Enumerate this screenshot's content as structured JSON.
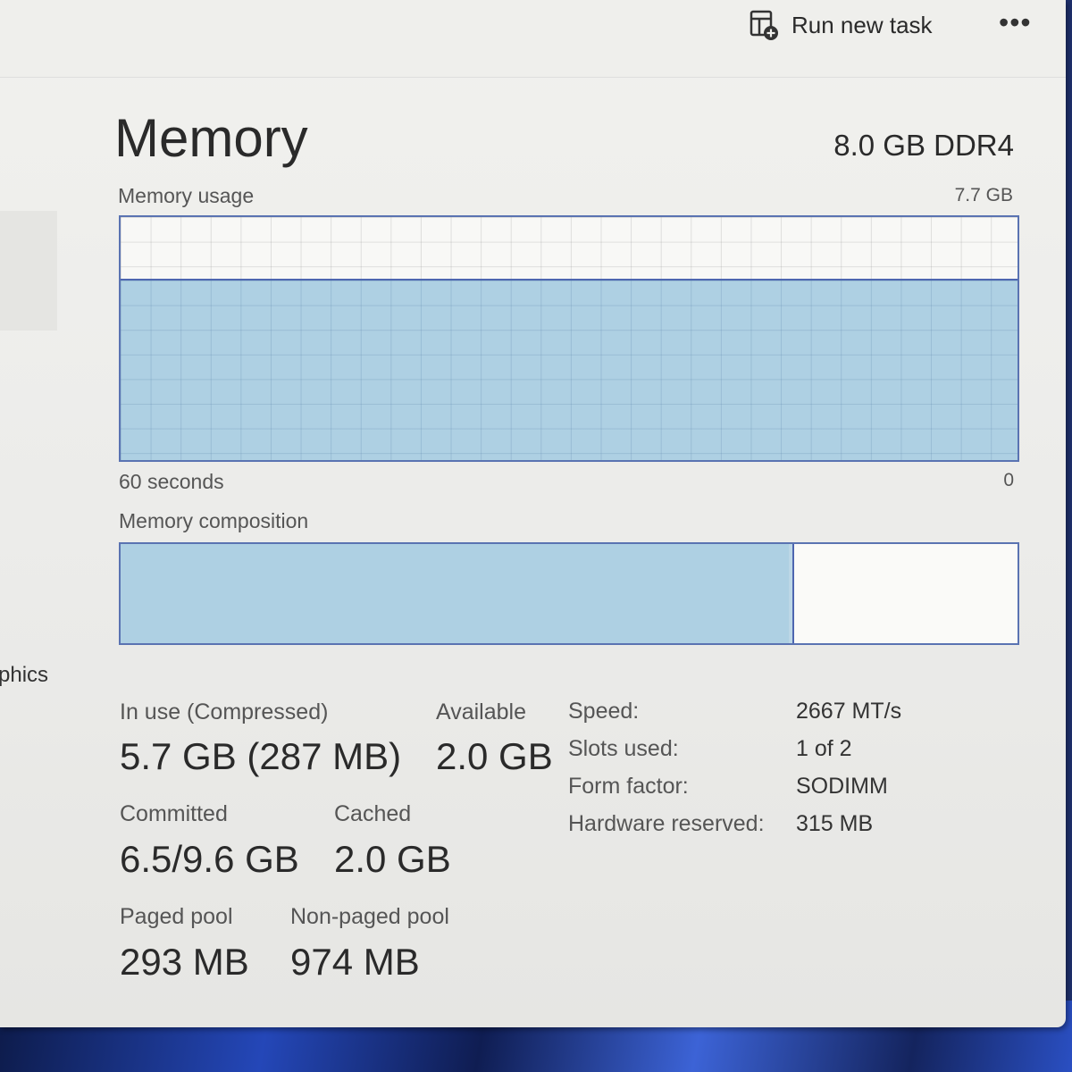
{
  "toolbar": {
    "run_new_task_label": "Run new task",
    "run_new_task_icon": "run-task-icon",
    "more_label": "•••"
  },
  "sidebar": {
    "partial_item_label": "phics"
  },
  "header": {
    "title": "Memory",
    "spec": "8.0 GB DDR4"
  },
  "usage": {
    "label": "Memory usage",
    "max_label": "7.7 GB",
    "time_label": "60 seconds",
    "time_end_label": "0",
    "fill_fraction": 0.74
  },
  "composition": {
    "label": "Memory composition",
    "in_use_fraction": 0.745,
    "modified_fraction": 0.004
  },
  "stats": {
    "in_use": {
      "label": "In use (Compressed)",
      "value": "5.7 GB (287 MB)"
    },
    "available": {
      "label": "Available",
      "value": "2.0 GB"
    },
    "committed": {
      "label": "Committed",
      "value": "6.5/9.6 GB"
    },
    "cached": {
      "label": "Cached",
      "value": "2.0 GB"
    },
    "paged_pool": {
      "label": "Paged pool",
      "value": "293 MB"
    },
    "non_paged_pool": {
      "label": "Non-paged pool",
      "value": "974 MB"
    }
  },
  "specs": {
    "speed": {
      "label": "Speed:",
      "value": "2667 MT/s"
    },
    "slots": {
      "label": "Slots used:",
      "value": "1 of 2"
    },
    "form_factor": {
      "label": "Form factor:",
      "value": "SODIMM"
    },
    "hw_reserved": {
      "label": "Hardware reserved:",
      "value": "315 MB"
    }
  },
  "colors": {
    "graph_fill": "#aed0e3",
    "graph_border": "#5a73b2",
    "graph_line": "#4d66b0"
  }
}
